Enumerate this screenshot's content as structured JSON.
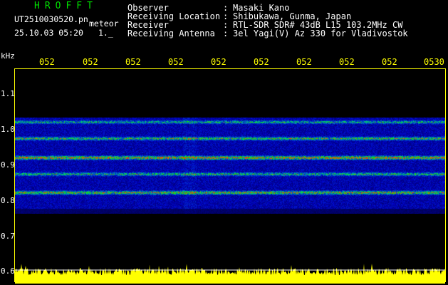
{
  "header": {
    "brand": "HROFFT",
    "filename": "UT2510030520.pn",
    "filename_suffix": "meteor",
    "timestamp": "25.10.03 05:20",
    "index": "1._"
  },
  "info": {
    "labels": [
      "Observer",
      "Receiving Location",
      "Receiver",
      "Receiving Antenna"
    ],
    "values": [
      "Masaki Kano",
      "Shibukawa, Gunma, Japan",
      "RTL-SDR SDR# 43dB L15 103.2MHz CW",
      "3el Yagi(V) Az 330 for Vladivostok"
    ]
  },
  "axis": {
    "unit": "kHz",
    "y_ticks": [
      "1.1",
      "1.0",
      "0.9",
      "0.8",
      "0.7",
      "0.6"
    ],
    "time_ticks": [
      "052",
      "052",
      "052",
      "052",
      "052",
      "052",
      "052",
      "052",
      "052",
      "0530"
    ]
  },
  "colors": {
    "background": "#000000",
    "text": "#ffffff",
    "time_labels": "#ffff00",
    "frame": "#ffff00",
    "brand": "#00e000",
    "amplitude": "#ffff00"
  }
}
